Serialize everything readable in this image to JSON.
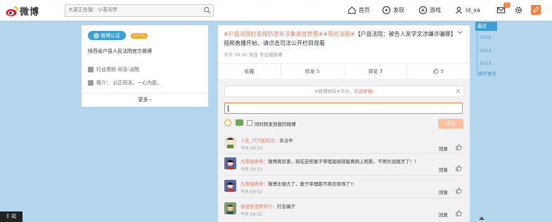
{
  "header": {
    "logo_text": "微博",
    "search_placeholder": "大家正在搜：小茗同学",
    "nav": {
      "home": "首页",
      "discover": "发现",
      "games": "游戏",
      "user": "ld_xa"
    },
    "message_count": "5"
  },
  "profile": {
    "verify_label": "微博认证",
    "level": "Lv.11",
    "org_name": "陕西省户县人民法院官方微博",
    "industry": "行业类别  司法-法院",
    "intro": "简介：  公正司法，一心为民。",
    "more": "更多 ›"
  },
  "post": {
    "tags": "#户县法院打击和防范非法集资宣传周##阳光法院#",
    "text": "【户县法院：被告人吴学文涉嫌诈骗罪】视频直播开始，请点击司法公开栏目观看",
    "meta": "今天 09:40 来自 专业版微博",
    "actions": {
      "favorite": "收藏",
      "forward": "转发 5",
      "comment": "评论 7",
      "like": "5"
    }
  },
  "comments_panel": {
    "promo_text": "#微博网谣#平台，",
    "promo_link": "欢迎举报!",
    "forward_label": "同时转发到我的微博",
    "submit_label": "评论",
    "reply_label": "回复",
    "items": [
      {
        "user": "人生_只只如初见：",
        "text": "关注中",
        "time": "今天 09:53"
      },
      {
        "user": "九零后奇奇：",
        "text": "微博真厉害，现在这些案子审理直接就能再网上观看，不用长途跋涉了！！",
        "time": "今天 09:53"
      },
      {
        "user": "九零后奇奇：",
        "text": "微博太强大了，案子审理都不用去现场了!!",
        "time": "今天 09:52"
      },
      {
        "user": "张进生活即修行：",
        "text": "打击骗子",
        "time": "今天 09:52"
      }
    ]
  },
  "timeline": {
    "current": "最近",
    "years": [
      "2015",
      "2014",
      "2013"
    ],
    "expand": "展开更多"
  },
  "corner_badge": "阝福",
  "colors": {
    "accent": "#fa7d3c",
    "link_orange": "#eb7350",
    "brand_blue": "#3c9ed7",
    "bg": "#b5d7ee"
  }
}
